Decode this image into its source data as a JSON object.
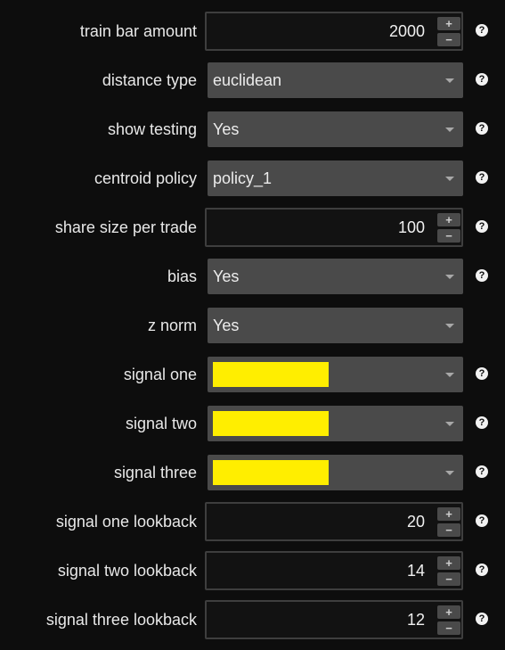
{
  "settings": [
    {
      "label": "train bar amount",
      "type": "number",
      "value": "2000",
      "help": true
    },
    {
      "label": "distance type",
      "type": "select",
      "value": "euclidean",
      "help": true
    },
    {
      "label": "show testing",
      "type": "select",
      "value": "Yes",
      "help": true
    },
    {
      "label": "centroid policy",
      "type": "select",
      "value": "policy_1",
      "help": true
    },
    {
      "label": "share size per trade",
      "type": "number",
      "value": "100",
      "help": true
    },
    {
      "label": "bias",
      "type": "select",
      "value": "Yes",
      "help": true
    },
    {
      "label": "z norm",
      "type": "select",
      "value": "Yes",
      "help": false
    },
    {
      "label": "signal one",
      "type": "color",
      "color": "#ffee00",
      "help": true
    },
    {
      "label": "signal two",
      "type": "color",
      "color": "#ffee00",
      "help": true
    },
    {
      "label": "signal three",
      "type": "color",
      "color": "#ffee00",
      "help": true
    },
    {
      "label": "signal one lookback",
      "type": "number",
      "value": "20",
      "help": true
    },
    {
      "label": "signal two lookback",
      "type": "number",
      "value": "14",
      "help": true
    },
    {
      "label": "signal three lookback",
      "type": "number",
      "value": "12",
      "help": true
    }
  ],
  "icons": {
    "increment": "+",
    "decrement": "−",
    "help": "?"
  },
  "colors": {
    "background": "#0d0d0d",
    "input_bg": "#121212",
    "select_bg": "#4a4a4a",
    "signal_color": "#ffee00"
  }
}
